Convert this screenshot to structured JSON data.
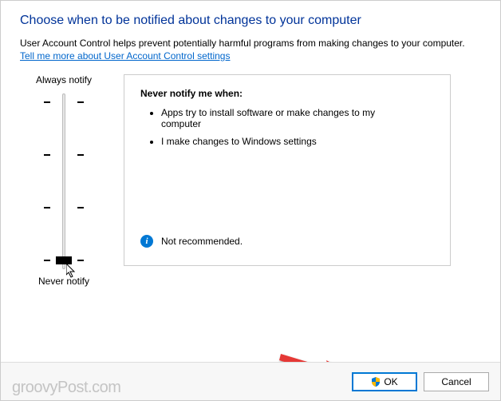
{
  "heading": "Choose when to be notified about changes to your computer",
  "description": "User Account Control helps prevent potentially harmful programs from making changes to your computer.",
  "link": "Tell me more about User Account Control settings",
  "slider": {
    "top_label": "Always notify",
    "bottom_label": "Never notify"
  },
  "panel": {
    "heading": "Never notify me when:",
    "bullets": [
      "Apps try to install software or make changes to my computer",
      "I make changes to Windows settings"
    ],
    "recommendation": "Not recommended."
  },
  "buttons": {
    "ok": "OK",
    "cancel": "Cancel"
  },
  "watermark": "groovyPost.com"
}
